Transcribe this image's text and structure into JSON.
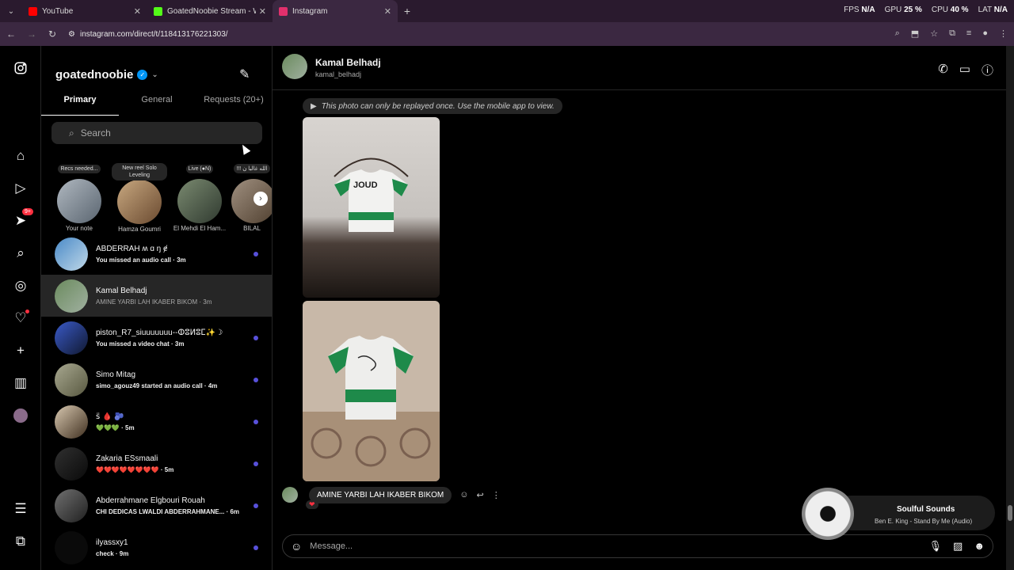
{
  "browser": {
    "tabs": [
      {
        "title": "YouTube",
        "color": "#ff0000"
      },
      {
        "title": "GoatedNoobie Stream - Watch",
        "color": "#53fc18"
      },
      {
        "title": "Instagram",
        "color": "#e1306c"
      }
    ],
    "url": "instagram.com/direct/t/118413176221303/",
    "hud": {
      "fps_label": "FPS",
      "fps": "N/A",
      "gpu_label": "GPU",
      "gpu": "25 %",
      "cpu_label": "CPU",
      "cpu": "40 %",
      "lat_label": "LAT",
      "lat": "N/A"
    }
  },
  "rail": {
    "notification_badge": "9+"
  },
  "inbox": {
    "username": "goatednoobie",
    "tabs": {
      "primary": "Primary",
      "general": "General",
      "requests": "Requests (20+)"
    },
    "search_placeholder": "Search",
    "notes": [
      {
        "bubble": "Recs needed...",
        "name": "Your note"
      },
      {
        "bubble": "New reel Solo Leveling",
        "name": "Hamza Goumri"
      },
      {
        "bubble": "Live (●N)",
        "name": "El Mehdi El Ham..."
      },
      {
        "bubble": "!!! الله غالبا ن",
        "name": "BILAL"
      }
    ],
    "conversations": [
      {
        "name": "ABDERRAH ʍ ɑ ŋ ɇ",
        "preview": "You missed an audio call · 3m",
        "unread": true
      },
      {
        "name": "Kamal Belhadj",
        "preview": "AMINE YARBI LAH IKABER BIKOM · 3m",
        "unread": false
      },
      {
        "name": "piston_R7_siuuuuuuu--ⵀⵓⵍⵓⵎ✨☽",
        "preview": "You missed a video chat · 3m",
        "unread": true
      },
      {
        "name": "Simo Mitag",
        "preview": "simo_agouz49 started an audio call · 4m",
        "unread": true
      },
      {
        "name": "ꜱ̈ 🩸 🫐",
        "preview": "💚💚💚 · 5m",
        "unread": true
      },
      {
        "name": "Zakaria ESsmaali",
        "preview": "❤️❤️❤️❤️❤️❤️❤️❤️ · 5m",
        "unread": true
      },
      {
        "name": "Abderrahmane Elgbouri Rouah",
        "preview": "CHI DEDICAS LWALDI ABDERRAHMANE... · 6m",
        "unread": true
      },
      {
        "name": "ilyassxy1",
        "preview": "check · 9m",
        "unread": true
      }
    ]
  },
  "chat": {
    "name": "Kamal Belhadj",
    "handle": "kamal_belhadj",
    "replay_notice": "This photo can only be replayed once. Use the mobile app to view.",
    "shirt_text": "JOUD",
    "message": "AMINE YARBI LAH IKABER BIKOM",
    "reaction": "❤",
    "composer_placeholder": "Message..."
  },
  "music": {
    "title": "Soulful Sounds",
    "subtitle": "Ben E. King - Stand By Me (Audio)"
  }
}
